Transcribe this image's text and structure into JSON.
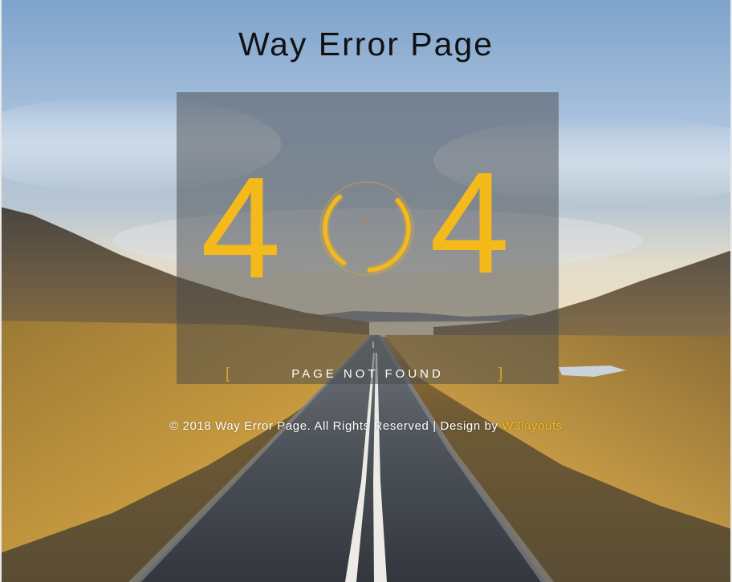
{
  "page": {
    "title": "Way Error Page"
  },
  "error": {
    "digit_left": "4",
    "digit_right": "4",
    "message": "PAGE NOT FOUND",
    "bracket_open": "[",
    "bracket_close": "]"
  },
  "footer": {
    "copyright": "© 2018 Way Error Page. All Rights Reserved | Design by ",
    "credit_link": "W3layouts"
  },
  "colors": {
    "accent": "#f4b91a",
    "title": "#111111",
    "panel": "rgba(70,72,76,0.5)"
  }
}
